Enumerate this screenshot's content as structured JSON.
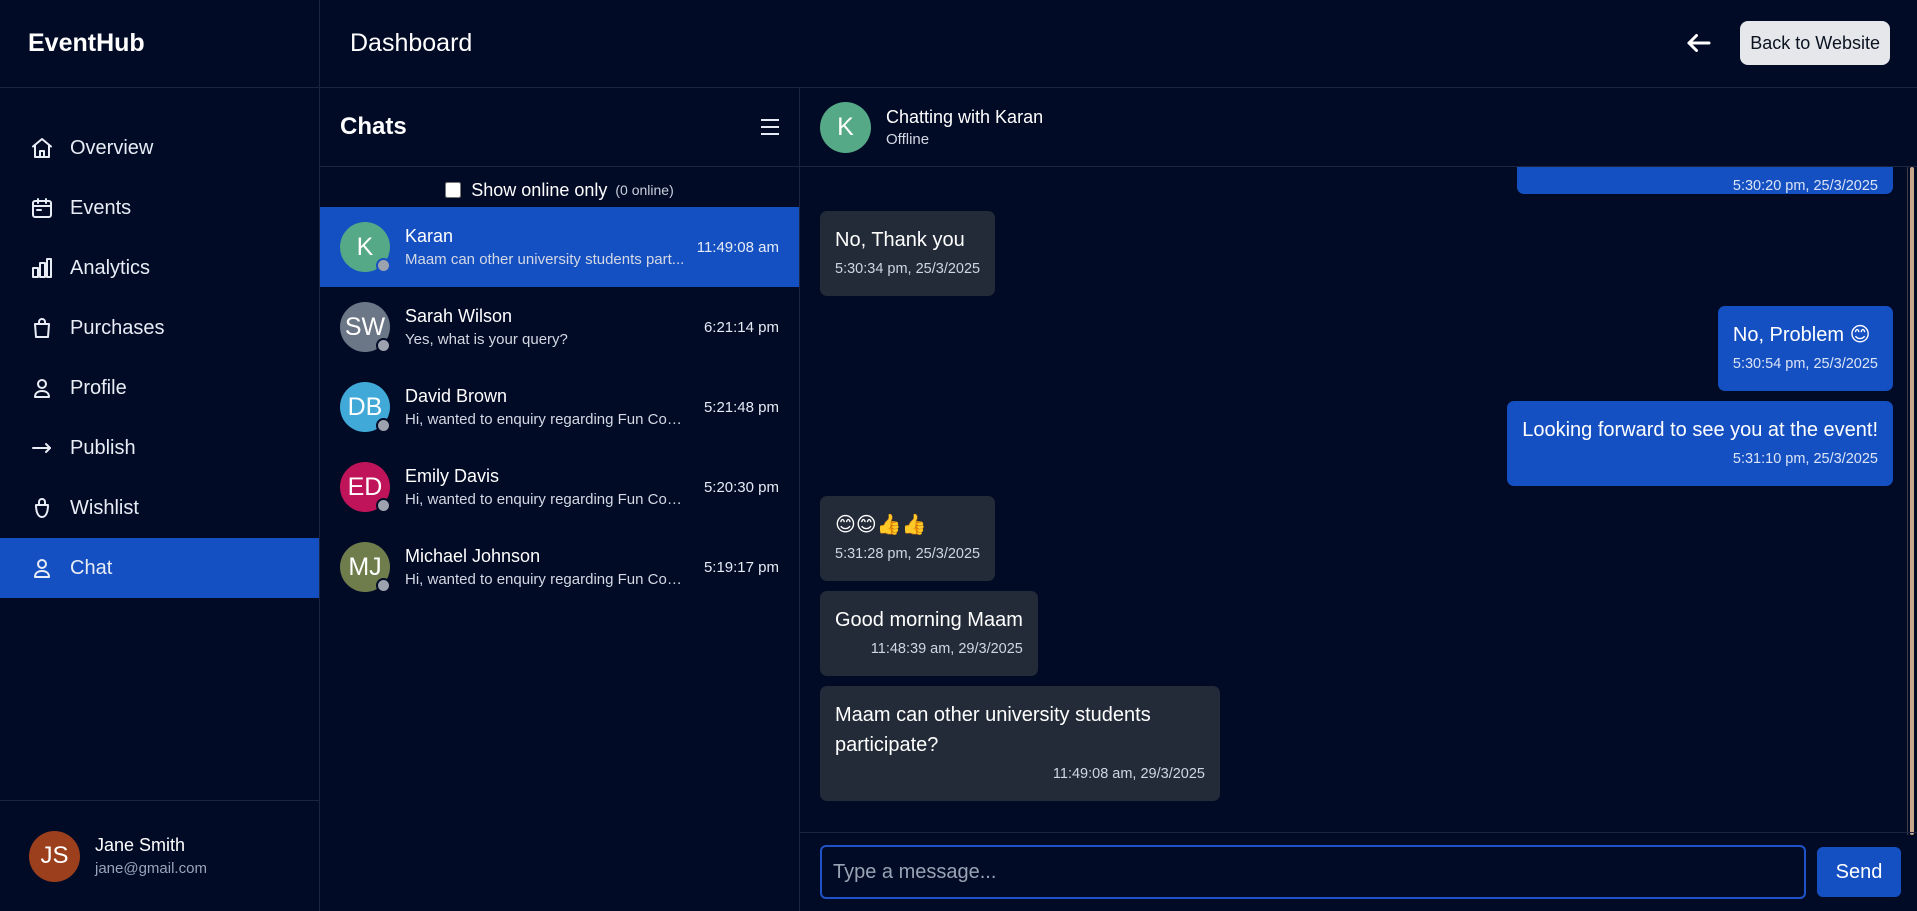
{
  "brand": "EventHub",
  "header": {
    "title": "Dashboard",
    "back_label": "Back to Website"
  },
  "sidebar": {
    "items": [
      {
        "label": "Overview",
        "icon": "home-icon"
      },
      {
        "label": "Events",
        "icon": "calendar-icon"
      },
      {
        "label": "Analytics",
        "icon": "bar-chart-icon"
      },
      {
        "label": "Purchases",
        "icon": "shopping-bag-icon"
      },
      {
        "label": "Profile",
        "icon": "user-icon"
      },
      {
        "label": "Publish",
        "icon": "arrow-right-icon"
      },
      {
        "label": "Wishlist",
        "icon": "bag-handle-icon"
      },
      {
        "label": "Chat",
        "icon": "user-icon",
        "active": true
      }
    ]
  },
  "user": {
    "initials": "JS",
    "name": "Jane Smith",
    "email": "jane@gmail.com"
  },
  "chatlist": {
    "title": "Chats",
    "filter_label": "Show online only",
    "online_count": "(0 online)",
    "chats": [
      {
        "initials": "K",
        "name": "Karan",
        "preview": "Maam can other university students part...",
        "time": "11:49:08 am",
        "color": "#55a986",
        "active": true
      },
      {
        "initials": "SW",
        "name": "Sarah Wilson",
        "preview": "Yes, what is your query?",
        "time": "6:21:14 pm",
        "color": "#6b7787"
      },
      {
        "initials": "DB",
        "name": "David Brown",
        "preview": "Hi, wanted to enquiry regarding Fun Codi...",
        "time": "5:21:48 pm",
        "color": "#40a9d8"
      },
      {
        "initials": "ED",
        "name": "Emily Davis",
        "preview": "Hi, wanted to enquiry regarding Fun Codi...",
        "time": "5:20:30 pm",
        "color": "#c0145a"
      },
      {
        "initials": "MJ",
        "name": "Michael Johnson",
        "preview": "Hi, wanted to enquiry regarding Fun Codi...",
        "time": "5:19:17 pm",
        "color": "#6f7d4d"
      }
    ]
  },
  "conversation": {
    "avatar": "K",
    "title": "Chatting with Karan",
    "status": "Offline",
    "messages": [
      {
        "dir": "out",
        "text": "",
        "time": "5:30:20 pm, 25/3/2025"
      },
      {
        "dir": "in",
        "text": "No, Thank you",
        "time": "5:30:34 pm, 25/3/2025"
      },
      {
        "dir": "out",
        "text": "No, Problem 😊",
        "time": "5:30:54 pm, 25/3/2025"
      },
      {
        "dir": "out",
        "text": "Looking forward to see you at the event!",
        "time": "5:31:10 pm, 25/3/2025"
      },
      {
        "dir": "in",
        "text": "😊😊👍👍",
        "time": "5:31:28 pm, 25/3/2025"
      },
      {
        "dir": "in",
        "text": "Good morning Maam",
        "time": "11:48:39 am, 29/3/2025"
      },
      {
        "dir": "in",
        "text": "Maam can other university students participate?",
        "time": "11:49:08 am, 29/3/2025"
      }
    ]
  },
  "composer": {
    "placeholder": "Type a message...",
    "send_label": "Send"
  }
}
